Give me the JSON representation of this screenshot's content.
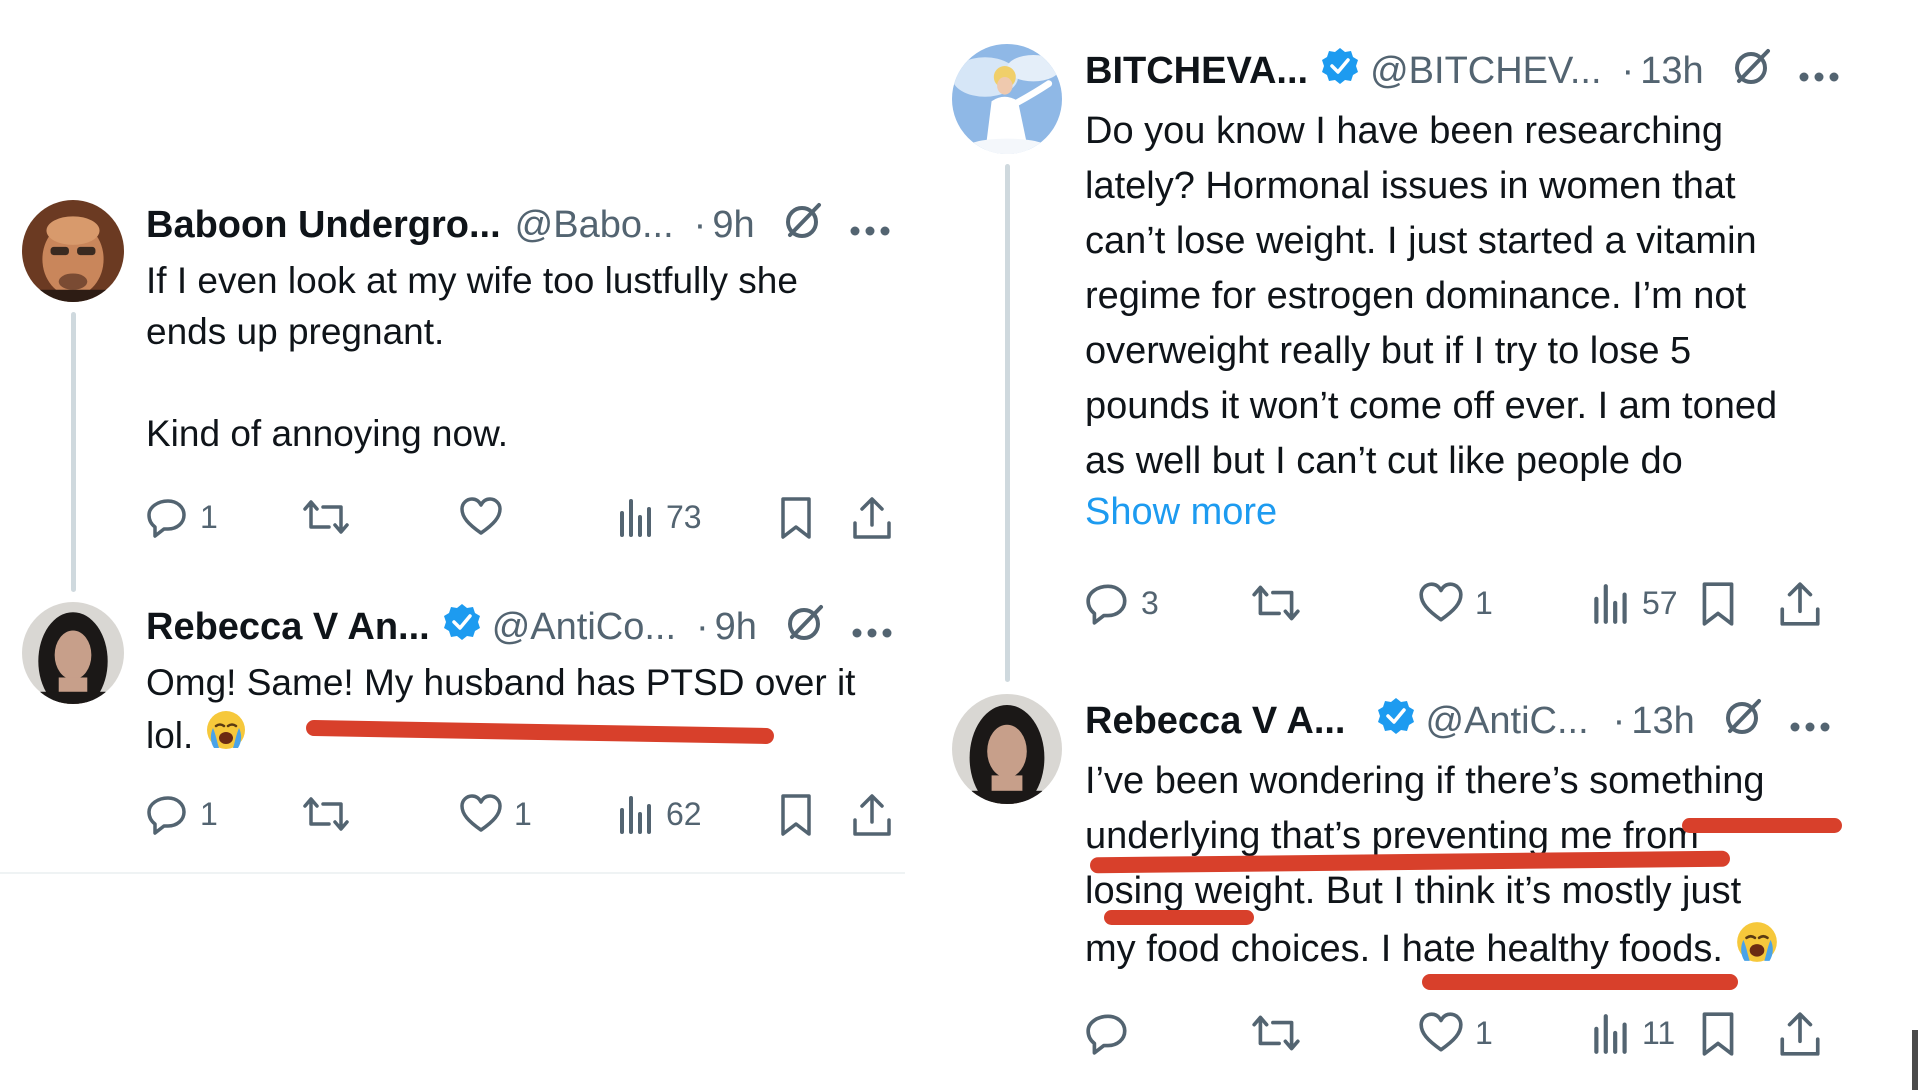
{
  "left": {
    "tweet1": {
      "name": "Baboon Undergro...",
      "handle": "@Babo...",
      "dot": "·",
      "time": "9h",
      "text": "If I even look at my wife too lustfully she\nends up pregnant.\n\nKind of annoying now.",
      "replies": "1",
      "likes": "",
      "views": "73"
    },
    "tweet2": {
      "name": "Rebecca V An...",
      "handle": "@AntiCo...",
      "dot": "·",
      "time": "9h",
      "text": "Omg! Same! My husband has PTSD over it\nlol. ",
      "replies": "1",
      "likes": "1",
      "views": "62"
    }
  },
  "right": {
    "tweet1": {
      "name": "BITCHEVA...",
      "handle": "@BITCHEV...",
      "dot": "·",
      "time": "13h",
      "text": "Do you know I have been researching\nlately? Hormonal issues in women that\ncan’t lose weight. I just started a vitamin\nregime for estrogen dominance. I’m not\noverweight really but if I try to lose 5\npounds it won’t come off ever. I am toned\nas well but I can’t cut like people do",
      "show_more": "Show more",
      "replies": "3",
      "likes": "1",
      "views": "57"
    },
    "tweet2": {
      "name": "Rebecca V A...",
      "handle": "@AntiC...",
      "dot": "·",
      "time": "13h",
      "text": "I’ve been wondering if there’s something\nunderlying that’s preventing me from\nlosing weight. But I think it’s mostly just\nmy food choices. I hate healthy foods. ",
      "replies": "",
      "likes": "1",
      "views": "11"
    }
  },
  "colors": {
    "text": "#0f1419",
    "secondary": "#536471",
    "link": "#1d9bf0",
    "verified": "#1d9bf0",
    "annotation": "#d8402b",
    "thread_line": "#cfd9de"
  },
  "icons": [
    "reply-icon",
    "retweet-icon",
    "like-icon",
    "views-icon",
    "bookmark-icon",
    "share-icon",
    "grok-icon",
    "more-icon",
    "verified-badge-icon",
    "crying-emoji-icon"
  ]
}
